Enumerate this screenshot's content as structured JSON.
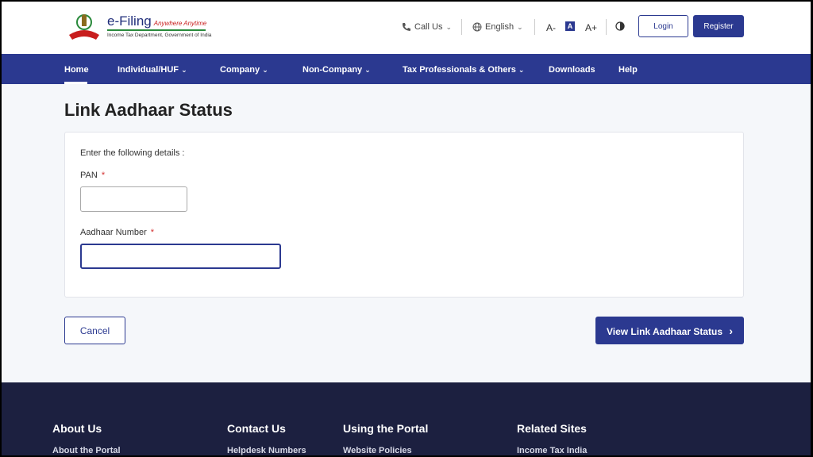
{
  "header": {
    "logo": {
      "title": "e-Filing",
      "tagline": "Anywhere Anytime",
      "subtitle": "Income Tax Department, Government of India"
    },
    "call_us": "Call Us",
    "language": "English",
    "font_decrease": "A-",
    "font_normal": "A",
    "font_increase": "A+",
    "login": "Login",
    "register": "Register"
  },
  "nav": {
    "items": [
      {
        "label": "Home"
      },
      {
        "label": "Individual/HUF"
      },
      {
        "label": "Company"
      },
      {
        "label": "Non-Company"
      },
      {
        "label": "Tax Professionals & Others"
      },
      {
        "label": "Downloads"
      },
      {
        "label": "Help"
      }
    ]
  },
  "main": {
    "title": "Link Aadhaar Status",
    "instruction": "Enter the following details :",
    "pan_label": "PAN",
    "pan_value": "",
    "aadhaar_label": "Aadhaar Number",
    "aadhaar_value": "",
    "required_mark": "*",
    "cancel": "Cancel",
    "submit": "View Link Aadhaar Status",
    "submit_chevron": "›"
  },
  "footer": {
    "columns": [
      {
        "heading": "About Us",
        "link": "About the Portal"
      },
      {
        "heading": "Contact Us",
        "link": "Helpdesk Numbers"
      },
      {
        "heading": "Using the Portal",
        "link": "Website Policies"
      },
      {
        "heading": "Related Sites",
        "link": "Income Tax India"
      }
    ]
  },
  "colors": {
    "primary": "#2b3990",
    "required": "#d32f2f",
    "footer_bg": "#1c2040"
  }
}
